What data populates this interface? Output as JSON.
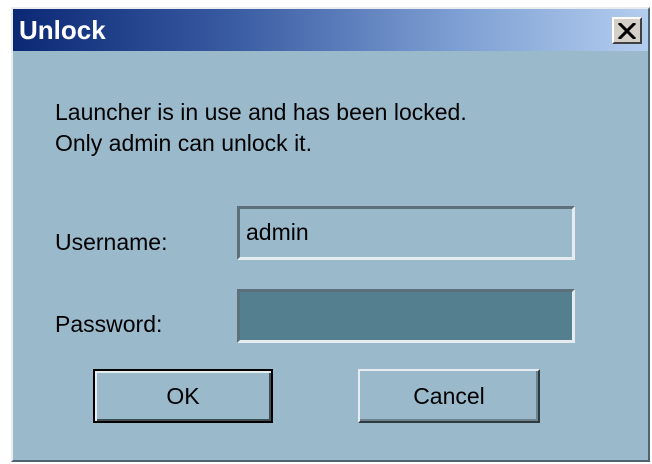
{
  "window": {
    "title": "Unlock",
    "close_label": "✕"
  },
  "message": {
    "line1": "Launcher is in use and has been locked.",
    "line2": "Only admin can unlock it."
  },
  "form": {
    "username_label": "Username:",
    "username_value": "admin",
    "password_label": "Password:",
    "password_value": ""
  },
  "buttons": {
    "ok_label": "OK",
    "cancel_label": "Cancel"
  },
  "colors": {
    "dialog_background": "#9ab9cb",
    "title_gradient_start": "#0b2874",
    "title_gradient_end": "#b3cdee",
    "password_field_background": "#537f8f"
  }
}
